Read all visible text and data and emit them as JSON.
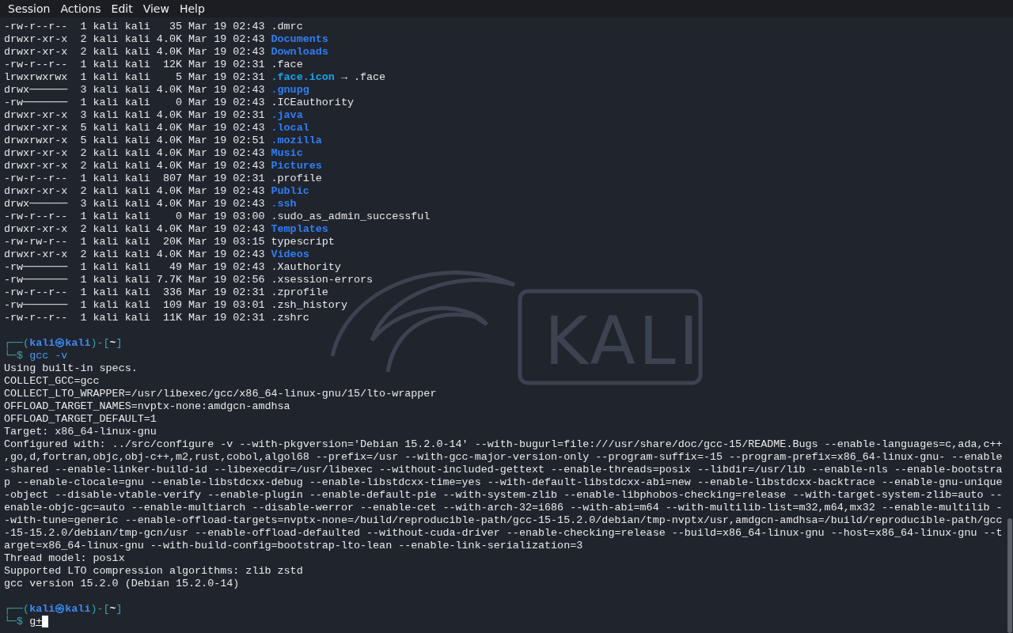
{
  "menu": [
    "Session",
    "Actions",
    "Edit",
    "View",
    "Help"
  ],
  "wallpaper": {
    "logo_text": "KALI"
  },
  "lines": [
    {
      "kind": "file",
      "details": "-rw-r--r--  1 kali kali   35 Mar 19 02:43",
      "name": ".dmrc"
    },
    {
      "kind": "dir",
      "details": "drwxr-xr-x  2 kali kali 4.0K Mar 19 02:43",
      "name": "Documents"
    },
    {
      "kind": "dir",
      "details": "drwxr-xr-x  2 kali kali 4.0K Mar 19 02:43",
      "name": "Downloads"
    },
    {
      "kind": "file",
      "details": "-rw-r--r--  1 kali kali  12K Mar 19 02:31",
      "name": ".face"
    },
    {
      "kind": "link",
      "details": "lrwxrwxrwx  1 kali kali    5 Mar 19 02:31",
      "name": ".face.icon",
      "target": "→ .face"
    },
    {
      "kind": "dir",
      "details": "drwx──────  3 kali kali 4.0K Mar 19 02:43",
      "name": ".gnupg"
    },
    {
      "kind": "file",
      "details": "-rw───────  1 kali kali    0 Mar 19 02:43",
      "name": ".ICEauthority"
    },
    {
      "kind": "dir",
      "details": "drwxr-xr-x  3 kali kali 4.0K Mar 19 02:31",
      "name": ".java"
    },
    {
      "kind": "dir",
      "details": "drwxr-xr-x  5 kali kali 4.0K Mar 19 02:43",
      "name": ".local"
    },
    {
      "kind": "dir",
      "details": "drwxrwxr-x  5 kali kali 4.0K Mar 19 02:51",
      "name": ".mozilla"
    },
    {
      "kind": "dir",
      "details": "drwxr-xr-x  2 kali kali 4.0K Mar 19 02:43",
      "name": "Music"
    },
    {
      "kind": "dir",
      "details": "drwxr-xr-x  2 kali kali 4.0K Mar 19 02:43",
      "name": "Pictures"
    },
    {
      "kind": "file",
      "details": "-rw-r--r--  1 kali kali  807 Mar 19 02:31",
      "name": ".profile"
    },
    {
      "kind": "dir",
      "details": "drwxr-xr-x  2 kali kali 4.0K Mar 19 02:43",
      "name": "Public"
    },
    {
      "kind": "dir",
      "details": "drwx──────  3 kali kali 4.0K Mar 19 02:43",
      "name": ".ssh"
    },
    {
      "kind": "file",
      "details": "-rw-r--r--  1 kali kali    0 Mar 19 03:00",
      "name": ".sudo_as_admin_successful"
    },
    {
      "kind": "dir",
      "details": "drwxr-xr-x  2 kali kali 4.0K Mar 19 02:43",
      "name": "Templates"
    },
    {
      "kind": "file",
      "details": "-rw-rw-r--  1 kali kali  20K Mar 19 03:15",
      "name": "typescript"
    },
    {
      "kind": "dir",
      "details": "drwxr-xr-x  2 kali kali 4.0K Mar 19 02:43",
      "name": "Videos"
    },
    {
      "kind": "file",
      "details": "-rw───────  1 kali kali   49 Mar 19 02:43",
      "name": ".Xauthority"
    },
    {
      "kind": "file",
      "details": "-rw───────  1 kali kali 7.7K Mar 19 02:56",
      "name": ".xsession-errors"
    },
    {
      "kind": "file",
      "details": "-rw-r--r--  1 kali kali  336 Mar 19 02:31",
      "name": ".zprofile"
    },
    {
      "kind": "file",
      "details": "-rw───────  1 kali kali  109 Mar 19 03:01",
      "name": ".zsh_history"
    },
    {
      "kind": "file",
      "details": "-rw-r--r--  1 kali kali  11K Mar 19 02:31",
      "name": ".zshrc"
    },
    {
      "kind": "blank"
    },
    {
      "kind": "prompt",
      "open": "┌──(",
      "user": "kali㉿kali",
      "mid": ")-[",
      "dir": "~",
      "close": "]"
    },
    {
      "kind": "command",
      "corner": "└─$",
      "text": "gcc -v",
      "pending": false,
      "cursor": false
    },
    {
      "kind": "output",
      "text": "Using built-in specs."
    },
    {
      "kind": "output",
      "text": "COLLECT_GCC=gcc"
    },
    {
      "kind": "output",
      "text": "COLLECT_LTO_WRAPPER=/usr/libexec/gcc/x86_64-linux-gnu/15/lto-wrapper"
    },
    {
      "kind": "output",
      "text": "OFFLOAD_TARGET_NAMES=nvptx-none:amdgcn-amdhsa"
    },
    {
      "kind": "output",
      "text": "OFFLOAD_TARGET_DEFAULT=1"
    },
    {
      "kind": "output",
      "text": "Target: x86_64-linux-gnu"
    },
    {
      "kind": "output",
      "text": "Configured with: ../src/configure -v --with-pkgversion='Debian 15.2.0-14' --with-bugurl=file:///usr/share/doc/gcc-15/README.Bugs --enable-languages=c,ada,c++"
    },
    {
      "kind": "output",
      "text": ",go,d,fortran,objc,obj-c++,m2,rust,cobol,algol68 --prefix=/usr --with-gcc-major-version-only --program-suffix=-15 --program-prefix=x86_64-linux-gnu- --enable"
    },
    {
      "kind": "output",
      "text": "-shared --enable-linker-build-id --libexecdir=/usr/libexec --without-included-gettext --enable-threads=posix --libdir=/usr/lib --enable-nls --enable-bootstra"
    },
    {
      "kind": "output",
      "text": "p --enable-clocale=gnu --enable-libstdcxx-debug --enable-libstdcxx-time=yes --with-default-libstdcxx-abi=new --enable-libstdcxx-backtrace --enable-gnu-unique"
    },
    {
      "kind": "output",
      "text": "-object --disable-vtable-verify --enable-plugin --enable-default-pie --with-system-zlib --enable-libphobos-checking=release --with-target-system-zlib=auto --"
    },
    {
      "kind": "output",
      "text": "enable-objc-gc=auto --enable-multiarch --disable-werror --enable-cet --with-arch-32=i686 --with-abi=m64 --with-multilib-list=m32,m64,mx32 --enable-multilib -"
    },
    {
      "kind": "output",
      "text": "-with-tune=generic --enable-offload-targets=nvptx-none=/build/reproducible-path/gcc-15-15.2.0/debian/tmp-nvptx/usr,amdgcn-amdhsa=/build/reproducible-path/gcc"
    },
    {
      "kind": "output",
      "text": "-15-15.2.0/debian/tmp-gcn/usr --enable-offload-defaulted --without-cuda-driver --enable-checking=release --build=x86_64-linux-gnu --host=x86_64-linux-gnu --t"
    },
    {
      "kind": "output",
      "text": "arget=x86_64-linux-gnu --with-build-config=bootstrap-lto-lean --enable-link-serialization=3"
    },
    {
      "kind": "output",
      "text": "Thread model: posix"
    },
    {
      "kind": "output",
      "text": "Supported LTO compression algorithms: zlib zstd"
    },
    {
      "kind": "output",
      "text": "gcc version 15.2.0 (Debian 15.2.0-14)"
    },
    {
      "kind": "blank"
    },
    {
      "kind": "prompt",
      "open": "┌──(",
      "user": "kali㉿kali",
      "mid": ")-[",
      "dir": "~",
      "close": "]"
    },
    {
      "kind": "command",
      "corner": "└─$",
      "text": "g+",
      "pending": true,
      "cursor": true
    }
  ]
}
